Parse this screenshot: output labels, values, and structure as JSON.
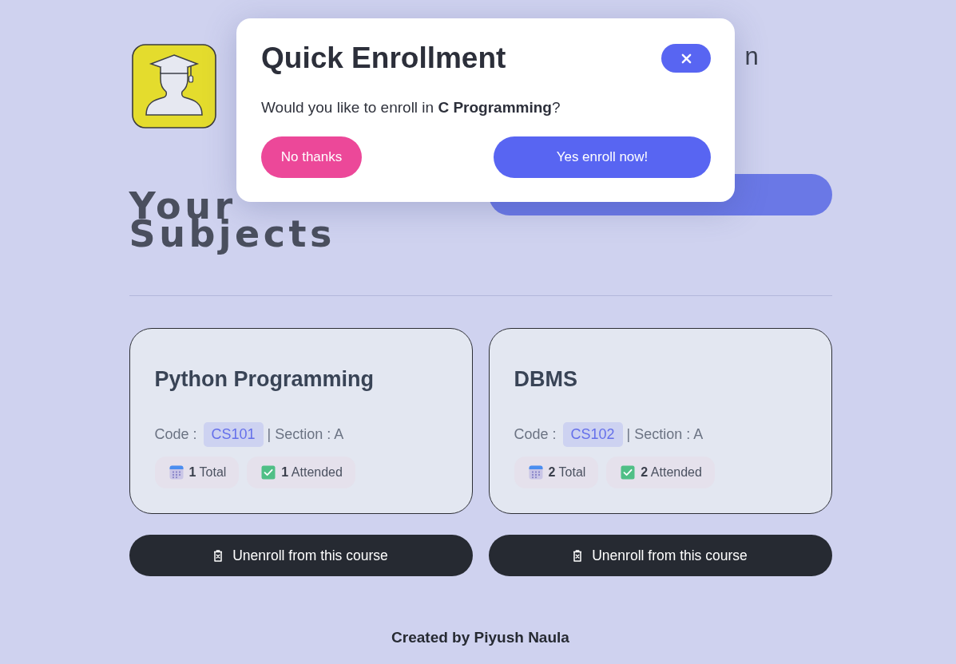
{
  "header": {
    "side_text": "n"
  },
  "heading": {
    "lines": [
      "Your",
      "Subjects"
    ]
  },
  "courses": [
    {
      "name": "Python Programming",
      "code_label": "Code :",
      "code": "CS101",
      "section": "| Section : A",
      "total": "**1** Total",
      "attended": "**1** Attended",
      "unenroll_label": "Unenroll from this course"
    },
    {
      "name": "DBMS",
      "code_label": "Code :",
      "code": "CS102",
      "section": "| Section : A",
      "total": "**2** Total",
      "attended": "**2** Attended",
      "unenroll_label": "Unenroll from this course"
    }
  ],
  "footer": "Created by Piyush Naula",
  "modal": {
    "title": "Quick Enrollment",
    "message": "Would you like to enroll in **C Programming**?",
    "buttons": [
      {
        "label": "No thanks",
        "kind": "decline"
      },
      {
        "label": "Yes enroll now!",
        "kind": "confirm"
      }
    ]
  }
}
